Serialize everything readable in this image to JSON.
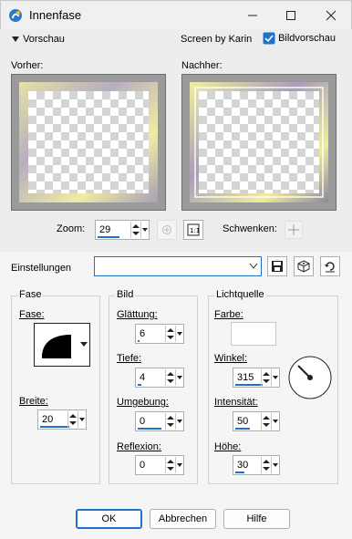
{
  "window": {
    "title": "Innenfase"
  },
  "topbar": {
    "vorschau_label": "Vorschau",
    "credit": "Screen by Karin",
    "bildvorschau_label": "Bildvorschau",
    "bildvorschau_checked": true
  },
  "preview": {
    "before_label": "Vorher:",
    "after_label": "Nachher:"
  },
  "zoom": {
    "label": "Zoom:",
    "value": "29",
    "pan_label": "Schwenken:"
  },
  "settings": {
    "label": "Einstellungen",
    "value": ""
  },
  "fase": {
    "title": "Fase",
    "fase_label": "Fase:",
    "breite_label": "Breite:",
    "breite_value": "20"
  },
  "bild": {
    "title": "Bild",
    "glaettung_label": "Glättung:",
    "glaettung_value": "6",
    "tiefe_label": "Tiefe:",
    "tiefe_value": "4",
    "umgebung_label": "Umgebung:",
    "umgebung_value": "0",
    "reflexion_label": "Reflexion:",
    "reflexion_value": "0"
  },
  "licht": {
    "title": "Lichtquelle",
    "farbe_label": "Farbe:",
    "farbe_color": "#ffffff",
    "winkel_label": "Winkel:",
    "winkel_value": "315",
    "intensitaet_label": "Intensität:",
    "intensitaet_value": "50",
    "hoehe_label": "Höhe:",
    "hoehe_value": "30"
  },
  "buttons": {
    "ok": "OK",
    "cancel": "Abbrechen",
    "help": "Hilfe"
  },
  "colors": {
    "accent": "#1e72c9",
    "bevel_gold": "#e8e39a",
    "bevel_violet": "#a79bb4"
  }
}
